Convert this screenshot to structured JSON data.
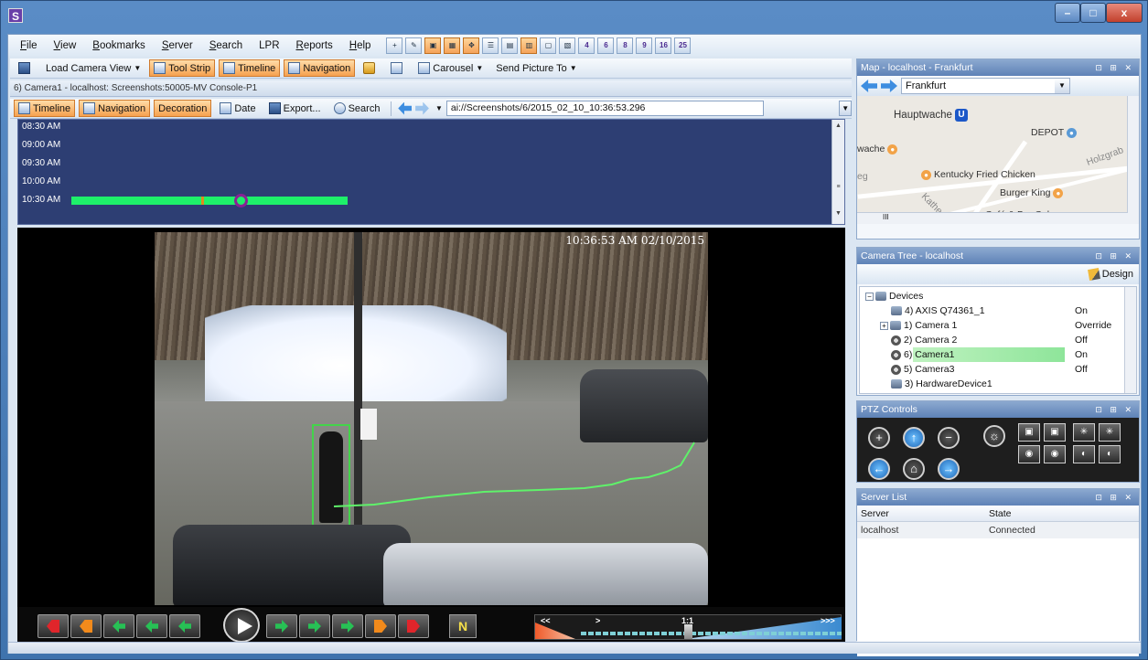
{
  "window": {
    "app_icon": "S",
    "controls": {
      "minimize": "–",
      "maximize": "□",
      "close": "x"
    }
  },
  "menu": {
    "items": [
      {
        "label": "File",
        "u": "F",
        "rest": "ile"
      },
      {
        "label": "View",
        "u": "V",
        "rest": "iew"
      },
      {
        "label": "Bookmarks",
        "u": "B",
        "rest": "ookmarks"
      },
      {
        "label": "Server",
        "u": "S",
        "rest": "erver"
      },
      {
        "label": "Search",
        "u": "S",
        "rest": "earch"
      },
      {
        "label": "LPR",
        "u": "",
        "rest": "LPR"
      },
      {
        "label": "Reports",
        "u": "R",
        "rest": "eports"
      },
      {
        "label": "Help",
        "u": "H",
        "rest": "elp"
      }
    ],
    "layout_buttons": [
      "4",
      "6",
      "8",
      "9",
      "16",
      "25"
    ]
  },
  "toolbar1": {
    "load_camera_view": "Load Camera View",
    "tool_strip": "Tool Strip",
    "timeline": "Timeline",
    "navigation": "Navigation",
    "carousel": "Carousel",
    "send_picture_to": "Send Picture To"
  },
  "camera": {
    "title": "6) Camera1 - localhost: Screenshots:50005-MV Console-P1",
    "toolbar": {
      "timeline": "Timeline",
      "navigation": "Navigation",
      "decoration": "Decoration",
      "date": "Date",
      "export": "Export...",
      "search": "Search",
      "path": "ai://Screenshots/6/2015_02_10_10:36:53.296"
    },
    "timeline_labels": [
      "08:30 AM",
      "09:00 AM",
      "09:30 AM",
      "10:00 AM",
      "10:30 AM"
    ],
    "osd_timestamp": "10:36:53 AM 02/10/2015"
  },
  "playback": {
    "speed_labels": {
      "slow": "<<",
      "normal": ">",
      "rate": "1:1",
      "fast": ">>>"
    },
    "tool_glyph": "N"
  },
  "map": {
    "title": "Map - localhost - Frankfurt",
    "location": "Frankfurt",
    "places": [
      {
        "name": "Hauptwache",
        "kind": "ubahn"
      },
      {
        "name": "DEPOT",
        "kind": "shop"
      },
      {
        "name": "wache",
        "kind": "food"
      },
      {
        "name": "Kentucky Fried Chicken",
        "kind": "food"
      },
      {
        "name": "Burger King",
        "kind": "food"
      },
      {
        "name": "Café & Bar Celona",
        "kind": "food"
      },
      {
        "name": "Holzgrab",
        "kind": "street"
      },
      {
        "name": "Kathe",
        "kind": "street"
      },
      {
        "name": "eg",
        "kind": "street"
      }
    ],
    "scroll_label": "III",
    "ubahn_glyph": "U"
  },
  "camera_tree": {
    "title": "Camera Tree - localhost",
    "design": "Design",
    "root": "Devices",
    "items": [
      {
        "label": "4) AXIS Q74361_1",
        "state": "On"
      },
      {
        "label": "1) Camera 1",
        "state": "Override"
      },
      {
        "label": "2) Camera 2",
        "state": "Off"
      },
      {
        "label": "6) Camera1",
        "state": "On"
      },
      {
        "label": "5) Camera3",
        "state": "Off"
      },
      {
        "label": "3) HardwareDevice1",
        "state": ""
      }
    ]
  },
  "ptz": {
    "title": "PTZ Controls"
  },
  "server_list": {
    "title": "Server List",
    "columns": [
      "Server",
      "State"
    ],
    "rows": [
      {
        "server": "localhost",
        "state": "Connected"
      }
    ]
  },
  "panel_controls": "⊡ ⊞ ✕",
  "colors": {
    "accent_orange": "#f6a14f",
    "timeline_bg": "#2d3e73",
    "record_green": "#1ef06a",
    "panel_header": "#5e82b7"
  }
}
